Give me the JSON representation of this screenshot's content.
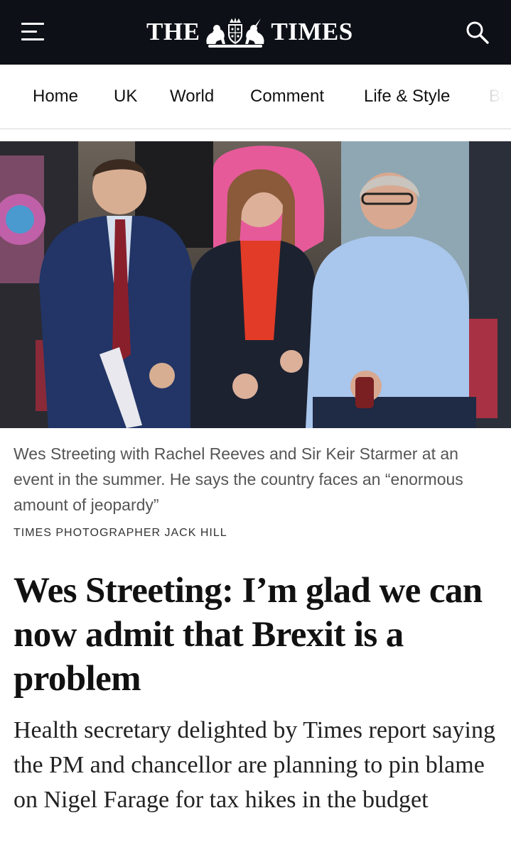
{
  "header": {
    "masthead_left": "THE",
    "masthead_right": "TIMES",
    "menu_icon": "hamburger-menu-icon",
    "search_icon": "search-icon",
    "background": "#0d1117"
  },
  "nav": {
    "items": [
      "Home",
      "UK",
      "World",
      "Comment",
      "Life & Style",
      "Bu"
    ]
  },
  "article": {
    "caption": "Wes Streeting with Rachel Reeves and Sir Keir Starmer at an event in the summer. He says the country faces an “enormous amount of jeopardy”",
    "credit": "TIMES PHOTOGRAPHER JACK HILL",
    "headline": "Wes Streeting: I’m glad we can now admit that Brexit is a problem",
    "standfirst": "Health secretary delighted by Times report saying the PM and chancellor are planning to pin blame on Nigel Farage for tax hikes in the budget"
  }
}
